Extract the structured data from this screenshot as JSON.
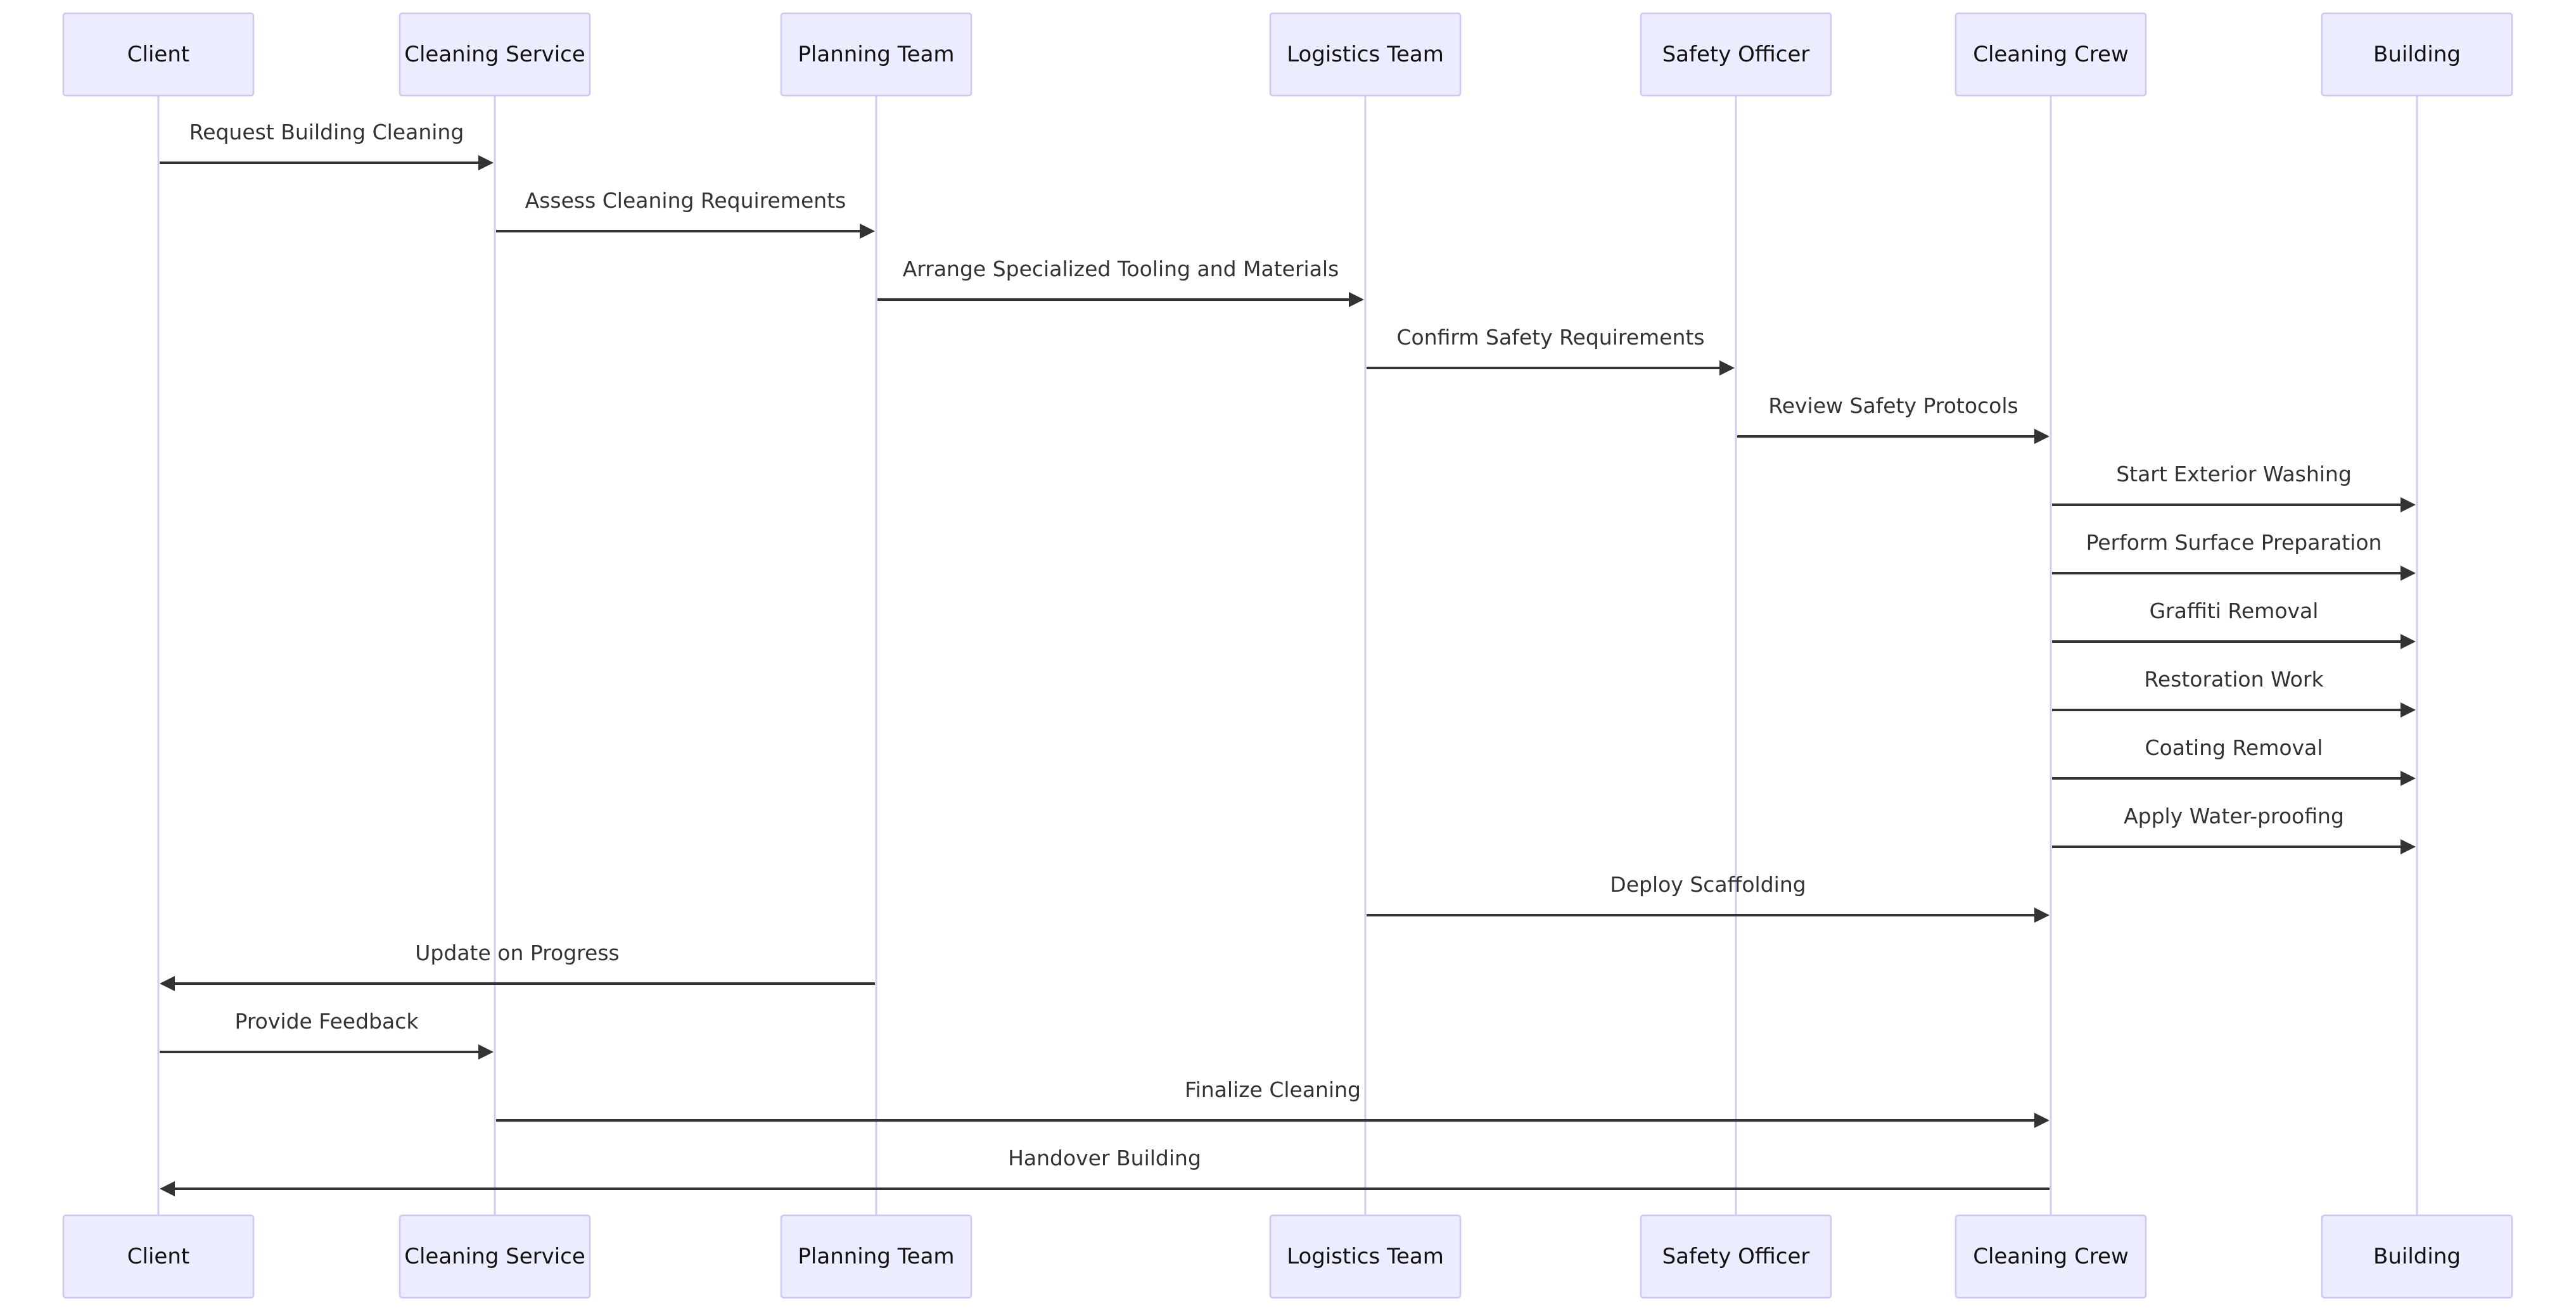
{
  "diagram": {
    "type": "sequence",
    "actors": [
      {
        "id": "client",
        "label": "Client"
      },
      {
        "id": "cleaning_service",
        "label": "Cleaning Service"
      },
      {
        "id": "planning_team",
        "label": "Planning Team"
      },
      {
        "id": "logistics_team",
        "label": "Logistics Team"
      },
      {
        "id": "safety_officer",
        "label": "Safety Officer"
      },
      {
        "id": "cleaning_crew",
        "label": "Cleaning Crew"
      },
      {
        "id": "building",
        "label": "Building"
      }
    ],
    "messages": [
      {
        "from": "client",
        "to": "cleaning_service",
        "label": "Request Building Cleaning"
      },
      {
        "from": "cleaning_service",
        "to": "planning_team",
        "label": "Assess Cleaning Requirements"
      },
      {
        "from": "planning_team",
        "to": "logistics_team",
        "label": "Arrange Specialized Tooling and Materials"
      },
      {
        "from": "logistics_team",
        "to": "safety_officer",
        "label": "Confirm Safety Requirements"
      },
      {
        "from": "safety_officer",
        "to": "cleaning_crew",
        "label": "Review Safety Protocols"
      },
      {
        "from": "cleaning_crew",
        "to": "building",
        "label": "Start Exterior Washing"
      },
      {
        "from": "cleaning_crew",
        "to": "building",
        "label": "Perform Surface Preparation"
      },
      {
        "from": "cleaning_crew",
        "to": "building",
        "label": "Graffiti Removal"
      },
      {
        "from": "cleaning_crew",
        "to": "building",
        "label": "Restoration Work"
      },
      {
        "from": "cleaning_crew",
        "to": "building",
        "label": "Coating Removal"
      },
      {
        "from": "cleaning_crew",
        "to": "building",
        "label": "Apply Water-proofing"
      },
      {
        "from": "logistics_team",
        "to": "cleaning_crew",
        "label": "Deploy Scaffolding"
      },
      {
        "from": "planning_team",
        "to": "client",
        "label": "Update on Progress"
      },
      {
        "from": "client",
        "to": "cleaning_service",
        "label": "Provide Feedback"
      },
      {
        "from": "cleaning_service",
        "to": "cleaning_crew",
        "label": "Finalize Cleaning"
      },
      {
        "from": "cleaning_crew",
        "to": "client",
        "label": "Handover Building"
      }
    ],
    "colors": {
      "actor_fill": "#ECECFF",
      "actor_border": "#CFC6F0",
      "lifeline": "#D3CCF2",
      "message": "#333333"
    }
  }
}
